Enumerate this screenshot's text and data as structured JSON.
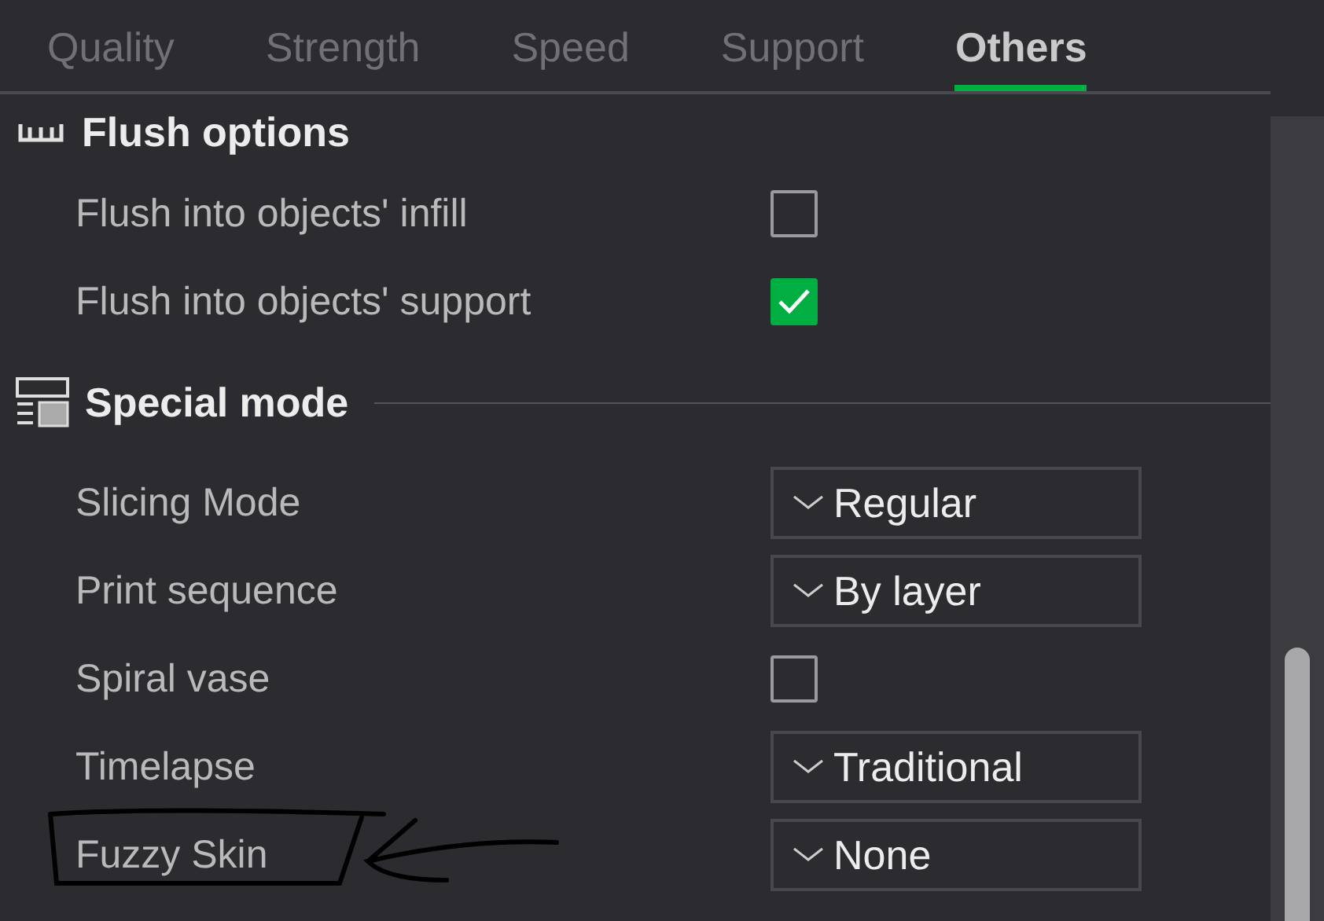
{
  "tabs": [
    {
      "label": "Quality",
      "selected": false
    },
    {
      "label": "Strength",
      "selected": false
    },
    {
      "label": "Speed",
      "selected": false
    },
    {
      "label": "Support",
      "selected": false
    },
    {
      "label": "Others",
      "selected": true
    }
  ],
  "sections": [
    {
      "title": "Flush options",
      "rows": [
        {
          "kind": "checkbox",
          "label": "Flush into objects' infill",
          "checked": false
        },
        {
          "kind": "checkbox",
          "label": "Flush into objects' support",
          "checked": true
        }
      ]
    },
    {
      "title": "Special mode",
      "rows": [
        {
          "kind": "dropdown",
          "label": "Slicing Mode",
          "value": "Regular"
        },
        {
          "kind": "dropdown",
          "label": "Print sequence",
          "value": "By layer"
        },
        {
          "kind": "checkbox",
          "label": "Spiral vase",
          "checked": false
        },
        {
          "kind": "dropdown",
          "label": "Timelapse",
          "value": "Traditional"
        },
        {
          "kind": "dropdown",
          "label": "Fuzzy Skin",
          "value": "None"
        }
      ]
    }
  ]
}
